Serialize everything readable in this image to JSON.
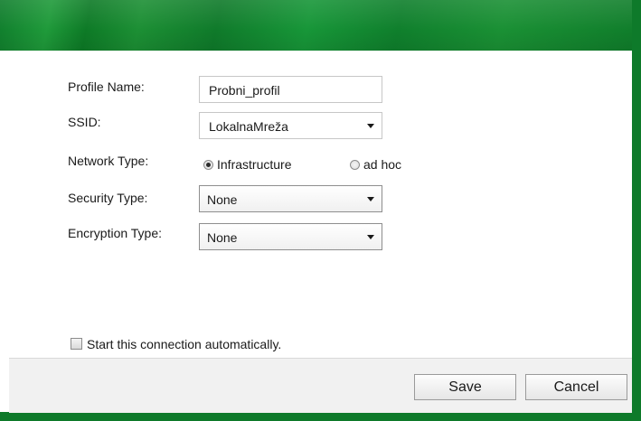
{
  "form": {
    "profile_name_label": "Profile Name:",
    "profile_name_value": "Probni_profil",
    "ssid_label": "SSID:",
    "ssid_value": "LokalnaMreža",
    "network_type_label": "Network Type:",
    "network_type_options": [
      "Infrastructure",
      "ad hoc"
    ],
    "network_type_selected": "Infrastructure",
    "security_type_label": "Security Type:",
    "security_type_value": "None",
    "encryption_type_label": "Encryption Type:",
    "encryption_type_value": "None",
    "auto_start_label": "Start this connection automatically.",
    "auto_start_checked": false
  },
  "buttons": {
    "save": "Save",
    "cancel": "Cancel"
  },
  "colors": {
    "frame_green": "#0e7a2a",
    "footer_bg": "#f1f1f1"
  }
}
